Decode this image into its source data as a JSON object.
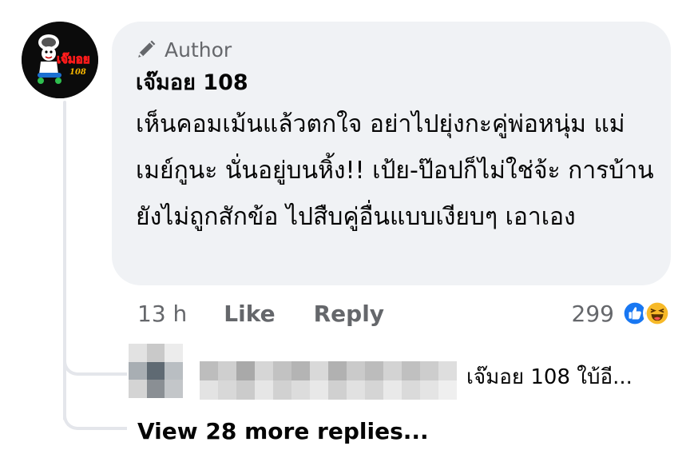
{
  "comment": {
    "badge_label": "Author",
    "badge_icon": "pencil-icon",
    "author_name": "เจ๊มอย 108",
    "text": "เห็นคอมเม้นแล้วตกใจ อย่าไปยุ่งกะคู่พ่อหนุ่ม แม่เมย์กูนะ นั่นอยู่บนหิ้ง!! เป้ย-ป๊อปก็ไม่ใช่จ้ะ การบ้านยังไม่ถูกสักข้อ ไปสืบคู่อื่นแบบเงียบๆ เอาเอง",
    "avatar": {
      "logo_text": "เจ๊มอย",
      "logo_number": "108"
    }
  },
  "actions": {
    "time": "13 h",
    "like_label": "Like",
    "reply_label": "Reply"
  },
  "reactions": {
    "count": "299",
    "icons": [
      "like-reaction-icon",
      "haha-reaction-icon"
    ],
    "like_color": "#1877f2",
    "haha_color": "#f7b928"
  },
  "reply": {
    "preview_text": "เจ๊มอย 108  ใบ้อี..."
  },
  "view_more_label": "View 28 more replies...",
  "colors": {
    "bubble": "#f0f2f5",
    "secondary_text": "#65676b",
    "primary_text": "#050505",
    "thread_line": "#e4e6eb"
  }
}
